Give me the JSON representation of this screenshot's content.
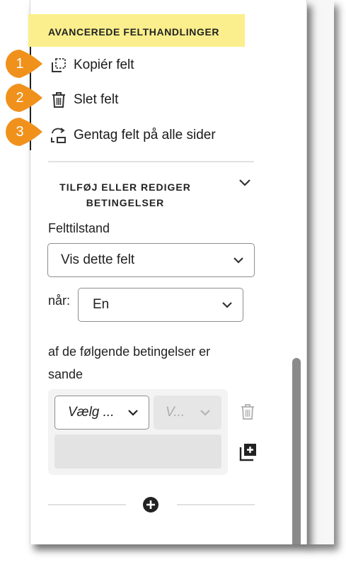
{
  "header": {
    "title": "AVANCEREDE FELTHANDLINGER"
  },
  "actions": [
    {
      "label": "Kopiér felt",
      "icon": "copy-icon",
      "badge": "1"
    },
    {
      "label": "Slet felt",
      "icon": "trash-icon",
      "badge": "2"
    },
    {
      "label": "Gentag felt på alle sider",
      "icon": "repeat-icon",
      "badge": "3"
    }
  ],
  "conditions": {
    "section_line1": "TILFØJ ELLER REDIGER",
    "section_line2": "BETINGELSER",
    "field_state_label": "Felttilstand",
    "field_state_value": "Vis dette felt",
    "when_label": "når:",
    "when_value": "En",
    "following_line1": "af de følgende betingelser er",
    "following_line2": "sande",
    "select_field": "Vælg ...",
    "select_value": "V..."
  },
  "colors": {
    "header_bg": "#faef8c",
    "badge": "#f0911c"
  }
}
